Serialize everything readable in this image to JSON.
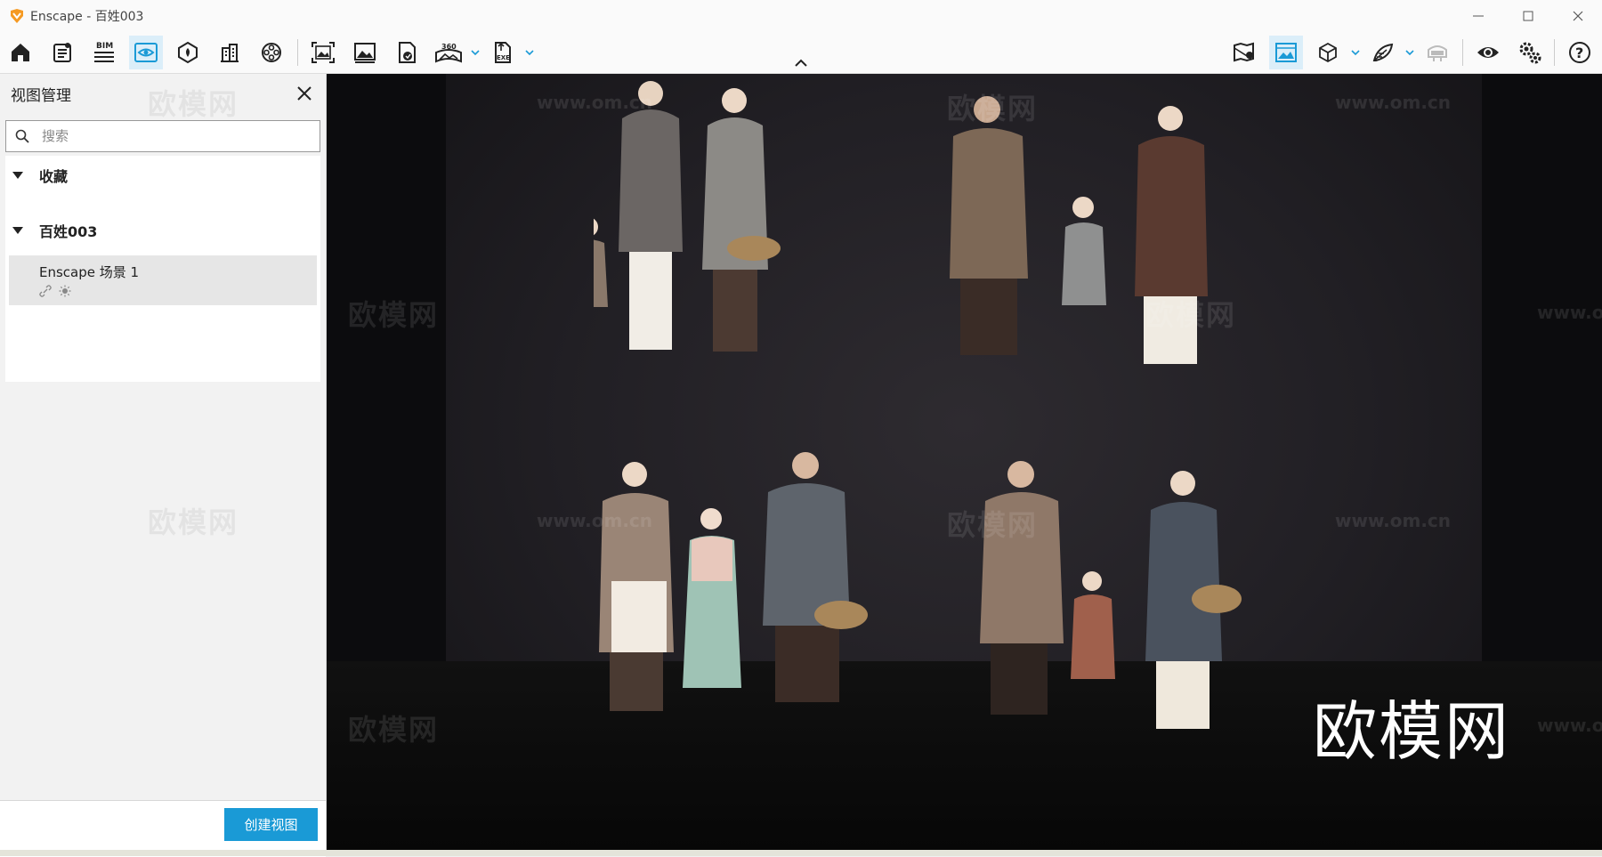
{
  "window": {
    "title": "Enscape - 百姓003",
    "controls": [
      "minimize-icon",
      "maximize-icon",
      "close-icon"
    ]
  },
  "toolbar": {
    "left_icons": [
      "home-icon",
      "assets-icon",
      "bim-icon",
      "views-icon",
      "materials-icon",
      "site-context-icon",
      "video-editor-icon",
      "batch-render-icon",
      "screenshot-icon",
      "panorama-icon",
      "360-icon",
      "export-exe-icon"
    ],
    "bim_label": "BIM",
    "pano_label": "360",
    "exe_label": "EXE",
    "right_icons": [
      "map-icon",
      "image-settings-icon",
      "cube-icon",
      "feather-icon",
      "vr-headset-icon",
      "visual-settings-icon",
      "settings-icon",
      "help-icon"
    ]
  },
  "sidebar": {
    "title": "视图管理",
    "search_placeholder": "搜索",
    "favorites_label": "收藏",
    "project_label": "百姓003",
    "view_item": {
      "name": "Enscape 场景 1",
      "icons": [
        "link-icon",
        "sun-icon"
      ]
    },
    "create_button": "创建视图"
  },
  "viewport": {
    "watermarks": [
      "欧模网",
      "www.om.cn"
    ],
    "big_watermark": "欧模网",
    "accent": "#1a9ad6"
  }
}
